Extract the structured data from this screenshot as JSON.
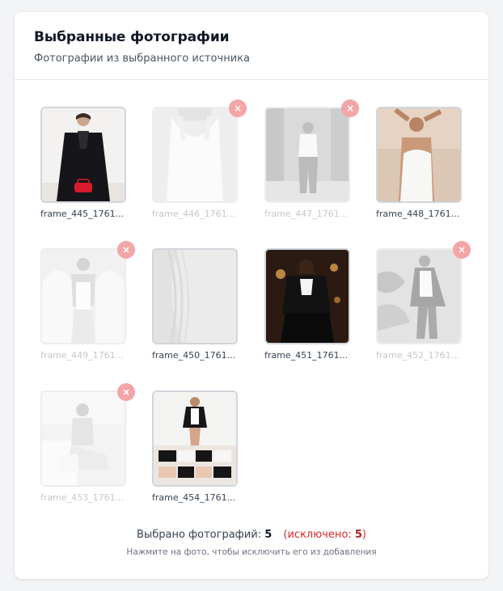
{
  "header": {
    "title": "Выбранные фотографии",
    "subtitle": "Фотографии из выбранного источника"
  },
  "photos": [
    {
      "filename": "frame_445_1761...",
      "excluded": false,
      "remove_label": "×"
    },
    {
      "filename": "frame_446_1761...",
      "excluded": true,
      "remove_label": "×"
    },
    {
      "filename": "frame_447_1761...",
      "excluded": true,
      "remove_label": "×"
    },
    {
      "filename": "frame_448_1761...",
      "excluded": false,
      "remove_label": "×"
    },
    {
      "filename": "frame_449_1761...",
      "excluded": true,
      "remove_label": "×"
    },
    {
      "filename": "frame_450_1761...",
      "excluded": false,
      "remove_label": "×"
    },
    {
      "filename": "frame_451_1761...",
      "excluded": false,
      "remove_label": "×"
    },
    {
      "filename": "frame_452_1761...",
      "excluded": true,
      "remove_label": "×"
    },
    {
      "filename": "frame_453_1761...",
      "excluded": true,
      "remove_label": "×"
    },
    {
      "filename": "frame_454_1761...",
      "excluded": false,
      "remove_label": "×"
    }
  ],
  "footer": {
    "selected_label": "Выбрано фотографий:",
    "selected_count": "5",
    "excluded_open": "(исключено:",
    "excluded_count": "5",
    "excluded_close": ")",
    "hint": "Нажмите на фото, чтобы исключить его из добавления"
  },
  "colors": {
    "remove_badge": "#f3a5a8",
    "excluded_text": "#dc2626"
  }
}
